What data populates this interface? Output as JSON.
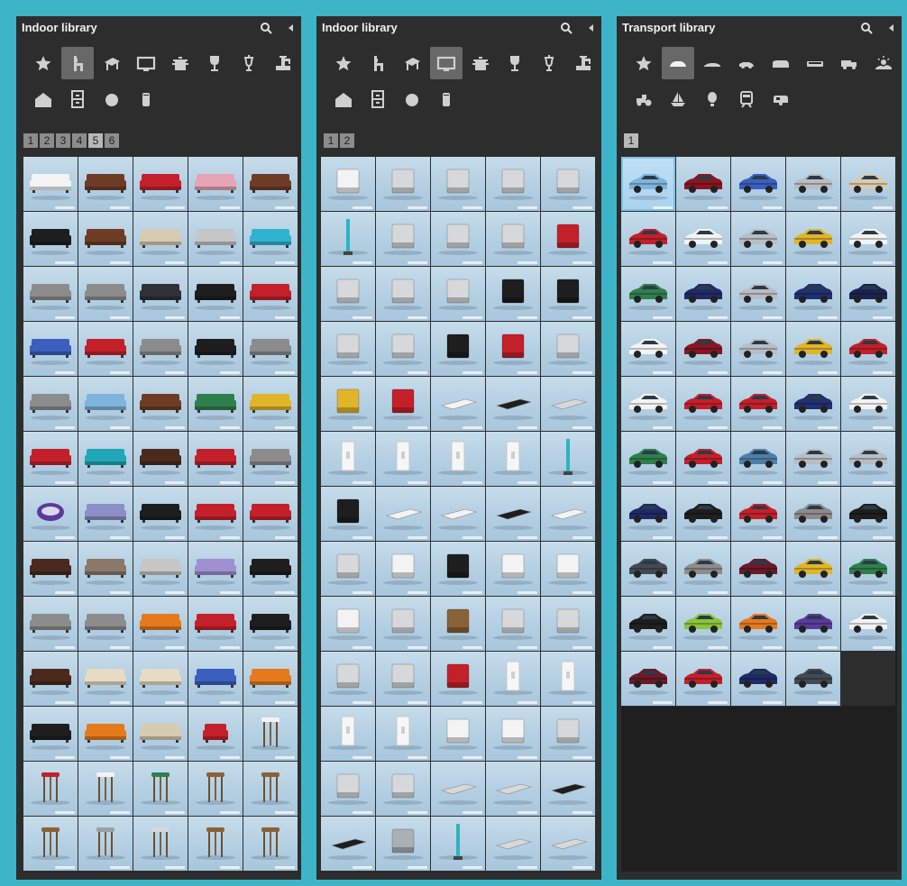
{
  "panels": [
    {
      "title": "Indoor library",
      "active_category": 1,
      "categories": [
        "star-icon",
        "chair-icon",
        "table-icon",
        "monitor-icon",
        "cooking-pot-icon",
        "wine-glass-icon",
        "lamp-icon",
        "tap-icon",
        "house-icon",
        "cabinet-icon",
        "ball-icon",
        "bin-icon"
      ],
      "pages": [
        "1",
        "2",
        "3",
        "4",
        "5",
        "6"
      ],
      "active_page": 4,
      "items": [
        "sofa-white-ornate",
        "sofa-brown-leather",
        "sofa-red",
        "sofa-pink",
        "sofa-brown-chesterfield",
        "sofa-black",
        "sofa-brown",
        "sofa-beige",
        "sofa-light-grey",
        "sofa-turquoise-sectional",
        "sofa-grey-modular",
        "sofa-grey-corner",
        "sofa-dark-corner",
        "sofa-black-corner",
        "sofa-red-small",
        "sofa-blue-long",
        "sofa-red-corner",
        "sofa-grey-cushions",
        "sofa-black-cushions",
        "sofa-grey-classic",
        "sofa-grey",
        "sofa-light-blue",
        "sofa-brown-leather",
        "sofa-green",
        "sofa-yellow",
        "sofa-red-sectional",
        "sofa-teal",
        "sofa-dark-brown",
        "sofa-red-modern",
        "sofa-grey-frame",
        "chair-purple-round",
        "sofa-lavender",
        "daybed-black",
        "daybed-red",
        "sofa-red-tufted",
        "sofa-chocolate",
        "sofa-taupe",
        "sofa-light-grey",
        "sofa-lilac",
        "sofa-black",
        "sofa-grey-long",
        "sofa-grey-square",
        "sofa-orange",
        "sofa-red-long",
        "sofa-black-long",
        "sofa-dark-brown",
        "sofa-cream",
        "sofa-cream-sectional",
        "sofa-blue",
        "sofa-orange-corner",
        "sofa-black-small",
        "sofa-orange-bed",
        "sofa-beige-curved",
        "armchair-red",
        "stool-white-round",
        "stool-red-bar",
        "stool-white-bar",
        "stool-green-bar",
        "stool-wood-cube",
        "stool-wood-frame",
        "stool-wood-x",
        "stool-metal",
        "stool-round-post",
        "stool-wood-three-leg",
        "stool-wood-tall"
      ]
    },
    {
      "title": "Indoor library",
      "active_category": 3,
      "categories": [
        "star-icon",
        "chair-icon",
        "table-icon",
        "monitor-icon",
        "cooking-pot-icon",
        "wine-glass-icon",
        "lamp-icon",
        "tap-icon",
        "house-icon",
        "cabinet-icon",
        "ball-icon",
        "bin-icon"
      ],
      "pages": [
        "1",
        "2"
      ],
      "active_page": -1,
      "items": [
        "heater-white",
        "air-conditioner",
        "ac-wall-unit",
        "ac-wall-unit-long",
        "radiator",
        "vacuum-stick",
        "wall-clock",
        "coffee-grinder",
        "coffee-maker",
        "espresso-machine-red",
        "imac",
        "laptop",
        "printer-tower",
        "fridge-black",
        "tv-box-black",
        "dishwasher",
        "laptop-open",
        "router-black",
        "toaster-red",
        "iron",
        "juicer-yellow",
        "kettle-red",
        "panel-white",
        "remote-black",
        "panel-thin",
        "light-switch",
        "light-switch",
        "light-switch",
        "light-switch",
        "floor-lamp",
        "speaker-black",
        "phone-white",
        "tablet-white",
        "phone-black",
        "tablet-white-2",
        "monitor",
        "mouse-white",
        "mouse-black",
        "mouse-white-2",
        "printer-white",
        "coffee-machine-white",
        "projector",
        "radio-wood",
        "speaker-retro",
        "rice-cooker",
        "air-purifier",
        "humidifier",
        "mouse-red",
        "socket",
        "socket-small",
        "socket-plate",
        "socket-double",
        "box-white",
        "router-white",
        "dvd-player",
        "set-top-box",
        "dvd-player-2",
        "tablet-flat",
        "tablet-flat-2",
        "tablet-black",
        "tablet-black-2",
        "kettle-steel",
        "desk-lamp",
        "cordless-phone",
        "desk-phone"
      ]
    },
    {
      "title": "Transport library",
      "active_category": 1,
      "categories": [
        "star-icon",
        "car-sedan-icon",
        "car-coupe-icon",
        "car-small-icon",
        "van-icon",
        "bus-icon",
        "truck-icon",
        "landscape-icon",
        "tractor-icon",
        "boat-icon",
        "balloon-icon",
        "train-icon",
        "caravan-icon"
      ],
      "pages": [
        "1"
      ],
      "active_page": 0,
      "items": [
        "car-light-blue",
        "car-dark-red",
        "car-blue",
        "car-silver",
        "car-beige",
        "car-red",
        "car-white",
        "car-silver-2",
        "car-yellow",
        "car-white-small",
        "car-green",
        "car-navy",
        "car-silver-3",
        "car-dark-blue",
        "car-dark-navy",
        "car-white-2",
        "car-dark-red-2",
        "car-silver-4",
        "car-yellow-2",
        "car-red-2",
        "car-white-3",
        "car-red-3",
        "car-red-4",
        "car-dark-blue-2",
        "car-white-4",
        "car-green-2",
        "car-red-5",
        "car-steel-blue",
        "car-silver-5",
        "car-silver-6",
        "car-navy-2",
        "car-black",
        "car-red-6",
        "car-grey",
        "car-black-2",
        "car-dark-grey",
        "car-grey-2",
        "car-maroon",
        "car-yellow-3",
        "car-green-3",
        "car-black-3",
        "car-lime",
        "car-orange",
        "car-purple",
        "car-white-5",
        "car-maroon-2",
        "car-red-7",
        "car-navy-3",
        "car-dark-grey-2"
      ]
    }
  ],
  "colors": {
    "frame": "#3db4c8",
    "panel": "#2d2d2d",
    "thumb_bg": "#b8d2e4",
    "active_cat": "#686868"
  }
}
